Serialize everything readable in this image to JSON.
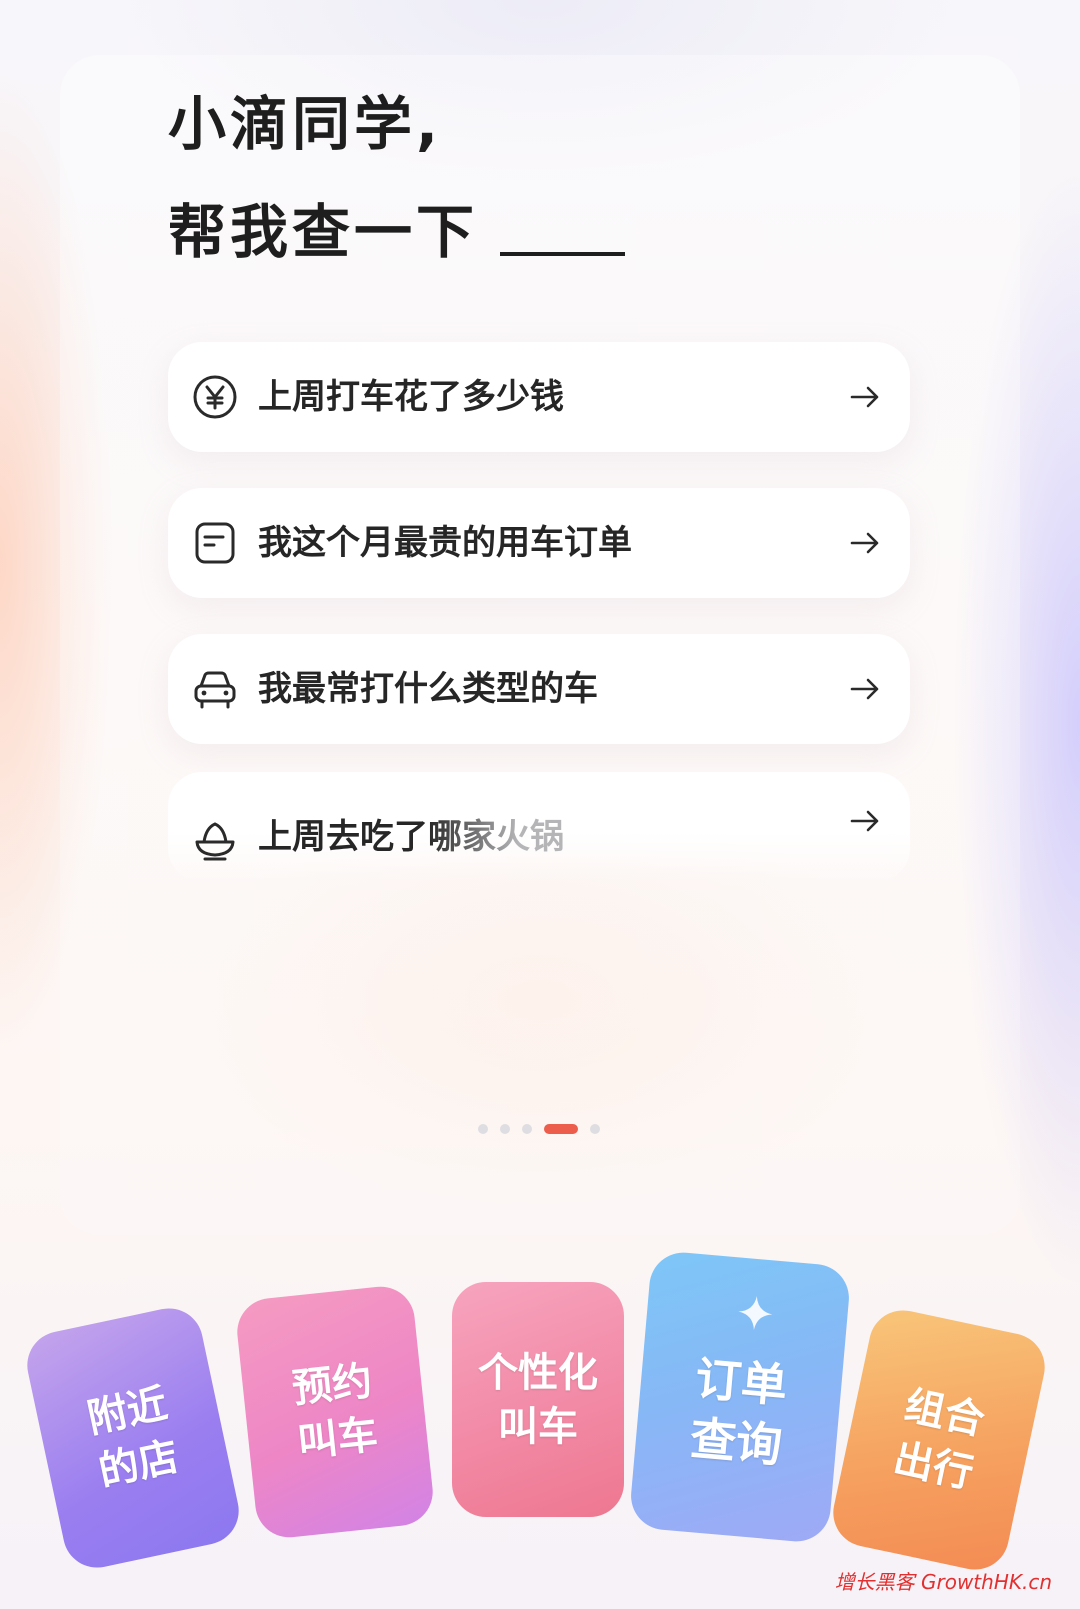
{
  "headline": {
    "line1": "小滴同学,",
    "line2": "帮我查一下"
  },
  "queries": [
    {
      "icon": "yuan-coin-icon",
      "label": "上周打车花了多少钱"
    },
    {
      "icon": "receipt-icon",
      "label": "我这个月最贵的用车订单"
    },
    {
      "icon": "car-icon",
      "label": "我最常打什么类型的车"
    },
    {
      "icon": "hotpot-bowl-icon",
      "label": "上周去吃了哪家火锅"
    }
  ],
  "pagination": {
    "count": 5,
    "active_index": 3,
    "active_color": "#ec5d4c"
  },
  "tiles": [
    {
      "label": "附近\n的店"
    },
    {
      "label": "预约\n叫车"
    },
    {
      "label": "个性化\n叫车"
    },
    {
      "label": "订单\n查询"
    },
    {
      "label": "组合\n出行"
    }
  ],
  "watermark": "增长黑客 GrowthHK.cn"
}
